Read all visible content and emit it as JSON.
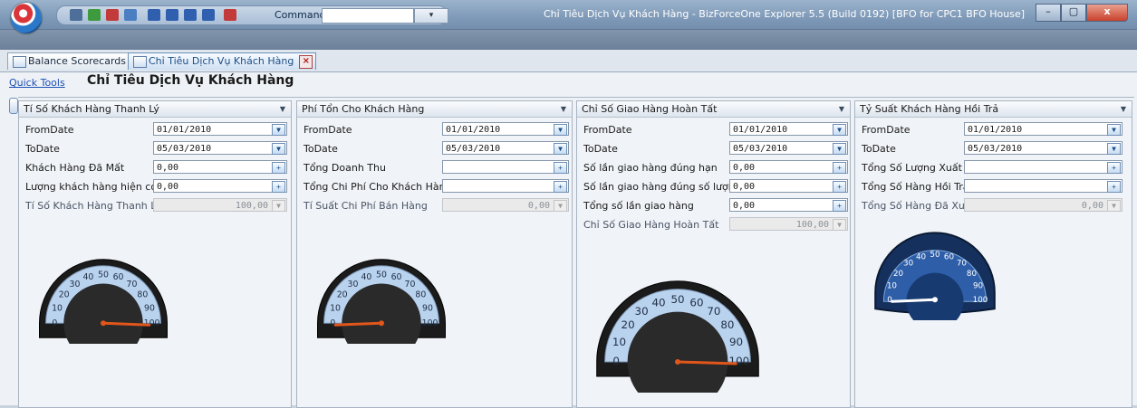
{
  "window": {
    "title": "Chỉ Tiêu Dịch Vụ Khách Hàng - BizForceOne Explorer 5.5 (Build 0192) [BFO for CPC1 BFO House]",
    "command_label": "Command",
    "command_value": "",
    "minimize_glyph": "–",
    "maximize_glyph": "▢",
    "close_glyph": "x"
  },
  "colors": {
    "accent": "#1d4f87",
    "link": "#1b4fb5",
    "titlebar": "#7f9ab8",
    "needle": "#e0561b"
  },
  "tabs": [
    {
      "label": "Balance Scorecards",
      "active": false
    },
    {
      "label": "Chỉ Tiêu Dịch Vụ Khách Hàng",
      "active": true,
      "close_glyph": "×"
    }
  ],
  "far_close_glyph": "×",
  "toolbar": {
    "quick_tools": "Quick Tools",
    "page_title": "Chỉ Tiêu Dịch Vụ Khách Hàng"
  },
  "icons": {
    "dropdown": "▾",
    "add": "+",
    "calendar": "▼",
    "panel_collapse": "▼"
  },
  "panels": [
    {
      "title": "Tí Số Khách Hàng Thanh Lý",
      "fields": [
        {
          "label": "FromDate",
          "value": "01/01/2010",
          "button": "▼",
          "disabled": false
        },
        {
          "label": "ToDate",
          "value": "05/03/2010",
          "button": "▼",
          "disabled": false
        },
        {
          "label": "Khách Hàng Đã Mất",
          "value": "0,00",
          "button": "+",
          "disabled": false
        },
        {
          "label": "Lượng khách hàng hiện có",
          "value": "0,00",
          "button": "+",
          "disabled": false
        },
        {
          "label": "Tí Số Khách Hàng Thanh Lý",
          "value": "100,00",
          "button": "▼",
          "disabled": true
        }
      ],
      "gauge": {
        "style": "dark",
        "ticks": [
          "0",
          "10",
          "20",
          "30",
          "40",
          "50",
          "60",
          "70",
          "80",
          "90",
          "100"
        ],
        "value": 100
      }
    },
    {
      "title": "Phí Tổn Cho Khách Hàng",
      "fields": [
        {
          "label": "FromDate",
          "value": "01/01/2010",
          "button": "▼",
          "disabled": false
        },
        {
          "label": "ToDate",
          "value": "05/03/2010",
          "button": "▼",
          "disabled": false
        },
        {
          "label": "Tổng Doanh Thu",
          "value": "",
          "button": "+",
          "disabled": false
        },
        {
          "label": "Tổng Chi Phí Cho Khách Hàng",
          "value": "",
          "button": "+",
          "disabled": false
        },
        {
          "label": "Tí Suất Chi Phí Bán Hàng",
          "value": "0,00",
          "button": "▼",
          "disabled": true
        }
      ],
      "gauge": {
        "style": "dark",
        "ticks": [
          "0",
          "10",
          "20",
          "30",
          "40",
          "50",
          "60",
          "70",
          "80",
          "90",
          "100"
        ],
        "value": 0
      }
    },
    {
      "title": "Chỉ Số Giao Hàng Hoàn Tất",
      "fields": [
        {
          "label": "FromDate",
          "value": "01/01/2010",
          "button": "▼",
          "disabled": false
        },
        {
          "label": "ToDate",
          "value": "05/03/2010",
          "button": "▼",
          "disabled": false
        },
        {
          "label": "Số lần giao hàng đúng hạn",
          "value": "0,00",
          "button": "+",
          "disabled": false
        },
        {
          "label": "Số lần giao hàng đúng số lượng",
          "value": "0,00",
          "button": "+",
          "disabled": false
        },
        {
          "label": "Tổng số lần giao hàng",
          "value": "0,00",
          "button": "+",
          "disabled": false
        },
        {
          "label": "Chỉ Số Giao Hàng Hoàn Tất",
          "value": "100,00",
          "button": "▼",
          "disabled": true
        }
      ],
      "gauge": {
        "style": "dark",
        "ticks": [
          "0",
          "10",
          "20",
          "30",
          "40",
          "50",
          "60",
          "70",
          "80",
          "90",
          "100"
        ],
        "value": 100
      }
    },
    {
      "title": "Tỷ Suất Khách Hàng Hồi Trả",
      "fields": [
        {
          "label": "FromDate",
          "value": "01/01/2010",
          "button": "▼",
          "disabled": false
        },
        {
          "label": "ToDate",
          "value": "05/03/2010",
          "button": "▼",
          "disabled": false
        },
        {
          "label": "Tổng Số Lượng Xuất",
          "value": "",
          "button": "+",
          "disabled": false
        },
        {
          "label": "Tổng Số Hàng Hồi Trả",
          "value": "",
          "button": "+",
          "disabled": false
        },
        {
          "label": "Tổng Số Hàng Đã Xuất",
          "value": "0,00",
          "button": "▼",
          "disabled": true
        }
      ],
      "gauge": {
        "style": "blue",
        "ticks": [
          "0",
          "10",
          "20",
          "30",
          "40",
          "50",
          "60",
          "70",
          "80",
          "90",
          "100"
        ],
        "value": 0
      }
    }
  ]
}
